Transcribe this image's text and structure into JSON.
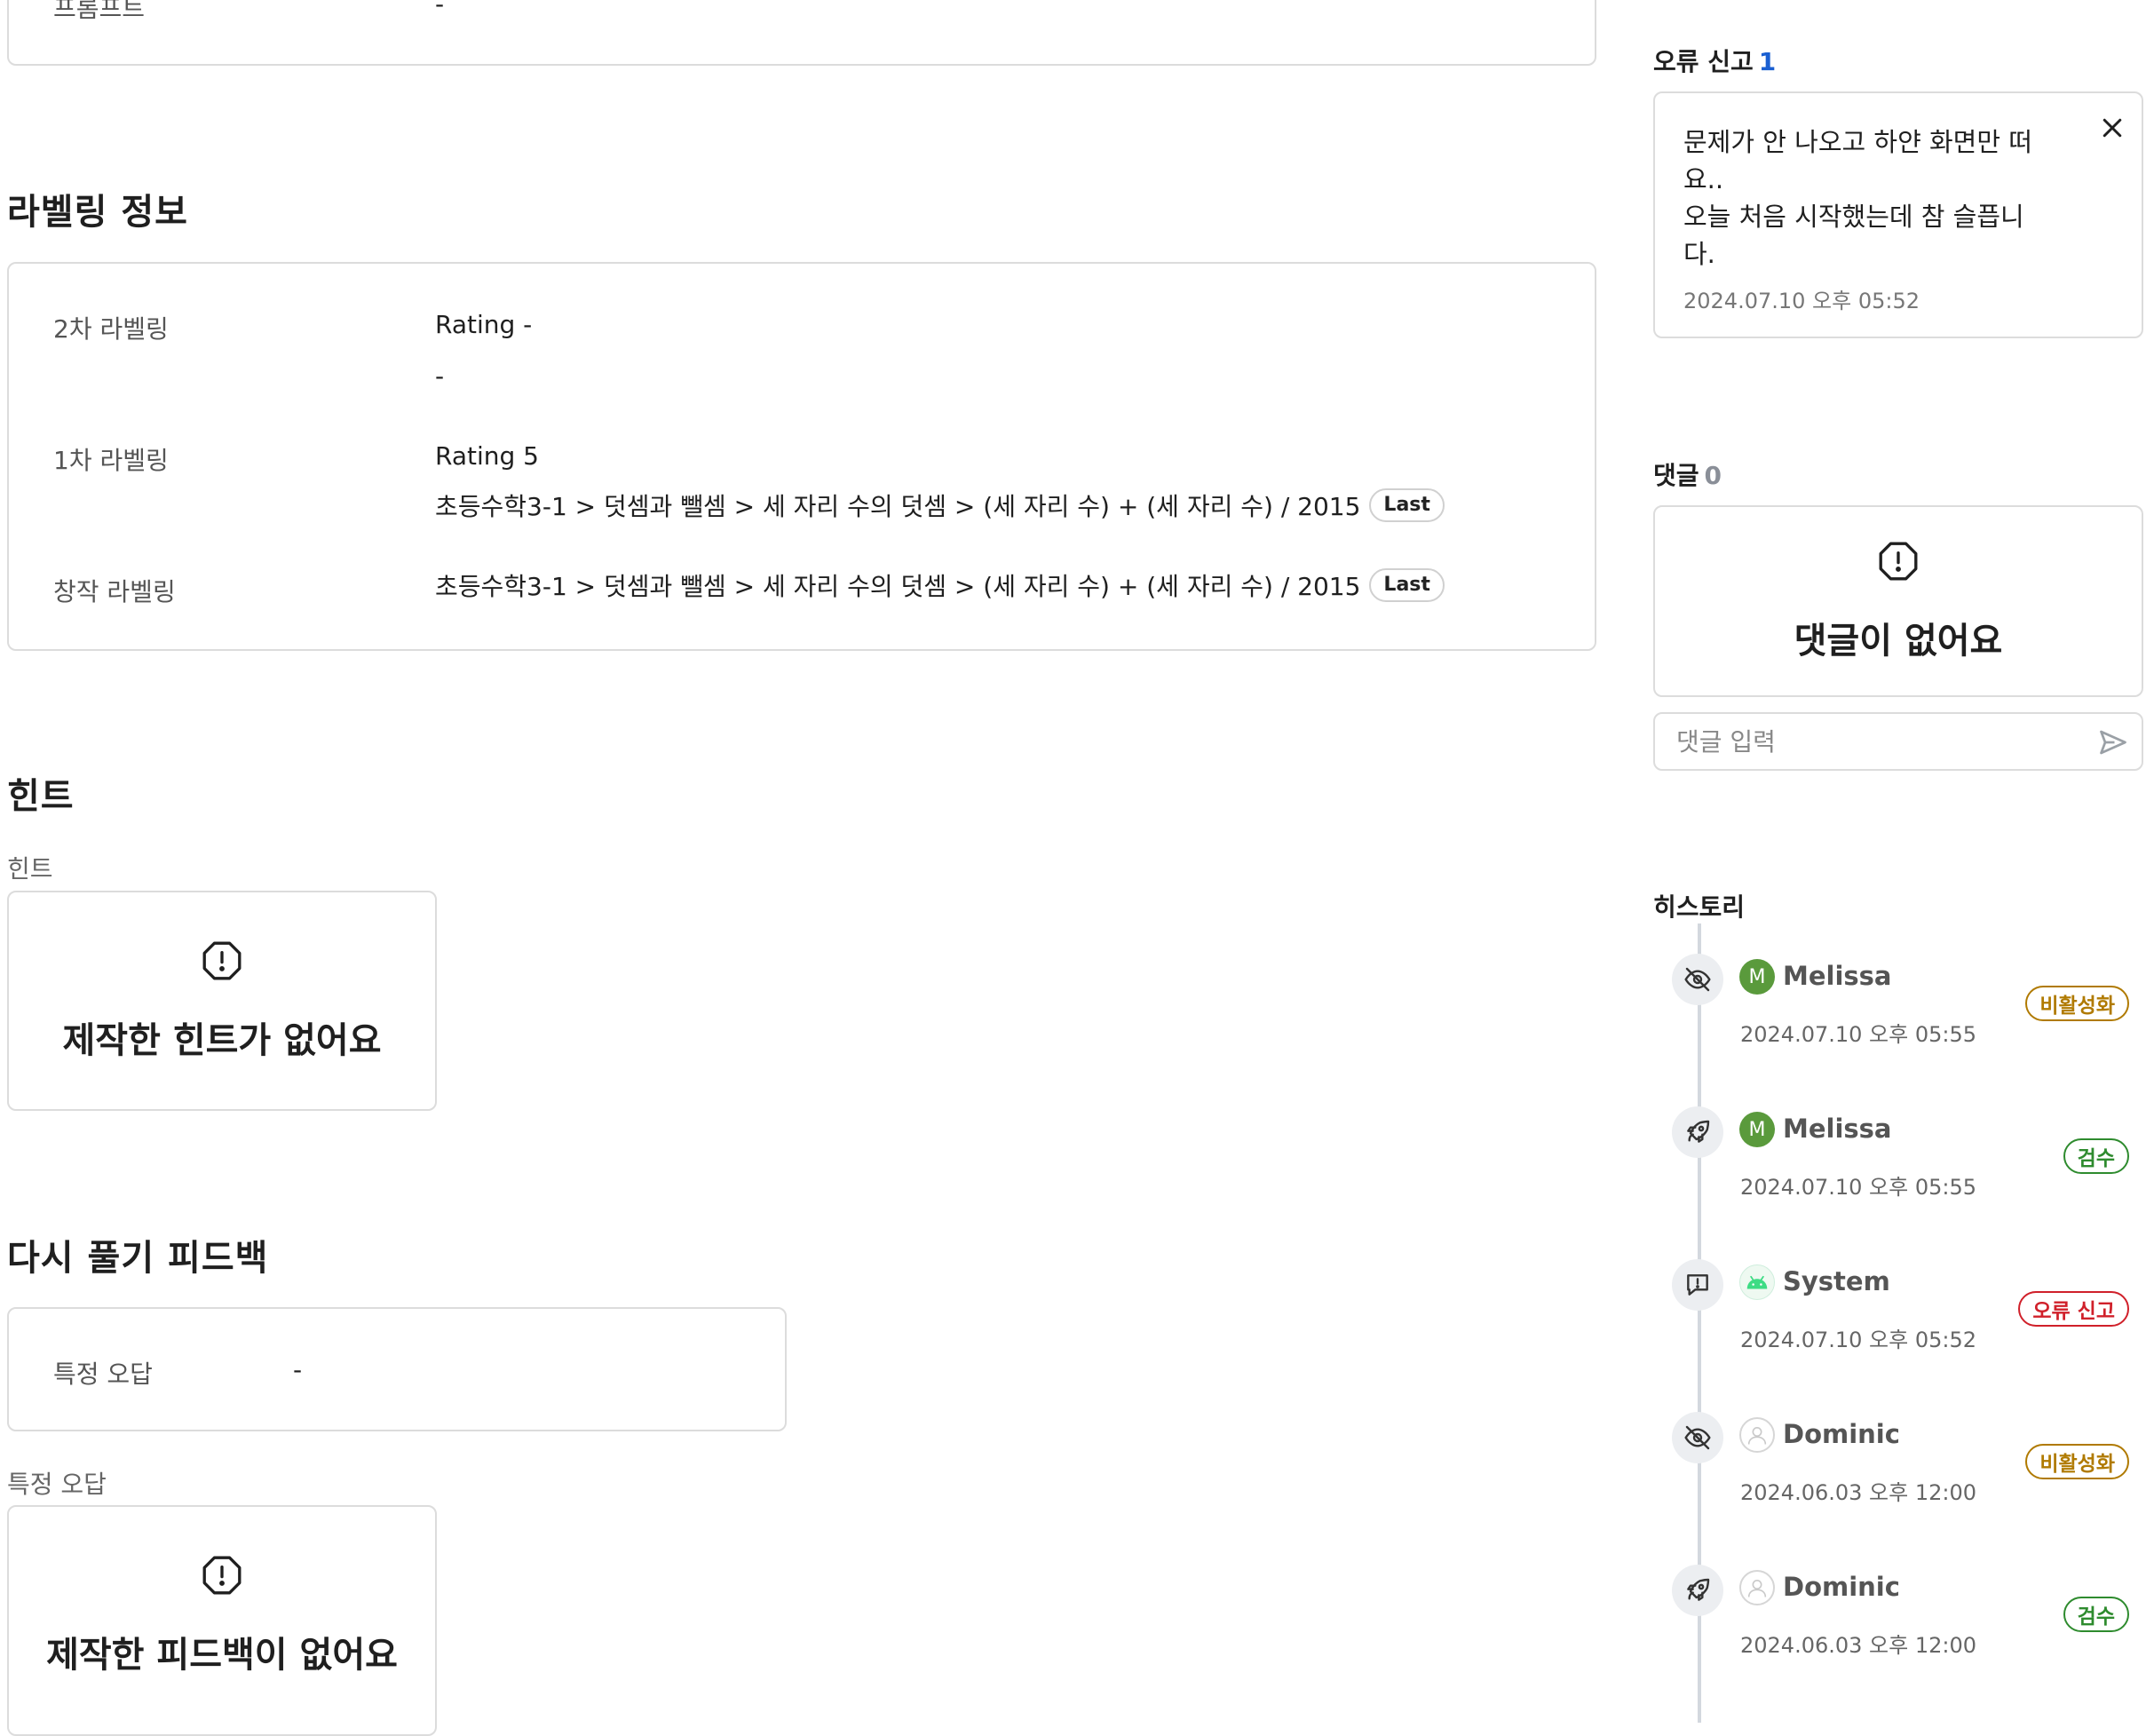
{
  "top": {
    "prompt_label": "프롬프트",
    "prompt_value": "-"
  },
  "labeling": {
    "title": "라벨링 정보",
    "second": {
      "label": "2차 라벨링",
      "rating": "Rating -",
      "value": "-"
    },
    "first": {
      "label": "1차 라벨링",
      "rating": "Rating 5",
      "path": "초등수학3-1 > 덧셈과 뺄셈 > 세 자리 수의 덧셈 > (세 자리 수) + (세 자리 수) / 2015",
      "tag": "Last"
    },
    "creation": {
      "label": "창작 라벨링",
      "path": "초등수학3-1 > 덧셈과 뺄셈 > 세 자리 수의 덧셈 > (세 자리 수) + (세 자리 수) / 2015",
      "tag": "Last"
    }
  },
  "hint": {
    "title": "힌트",
    "sublabel": "힌트",
    "empty": "제작한 힌트가 없어요"
  },
  "feedback": {
    "title": "다시 풀기 피드백",
    "row_label": "특정 오답",
    "row_value": "-",
    "sublabel": "특정 오답",
    "empty": "제작한 피드백이 없어요"
  },
  "error_report": {
    "title": "오류 신고",
    "count": "1",
    "text_lines": [
      "문제가 안 나오고 하얀 화면만 떠",
      "요..",
      "오늘 처음 시작했는데 참 슬픕니",
      "다."
    ],
    "time": "2024.07.10 오후 05:52"
  },
  "comments": {
    "title": "댓글",
    "count": "0",
    "empty": "댓글이 없어요",
    "input_placeholder": "댓글 입력"
  },
  "history": {
    "title": "히스토리",
    "events": [
      {
        "icon": "eye-off-icon",
        "avatar": "M",
        "avatar_color": "#5a9a3c",
        "name": "Melissa",
        "time": "2024.07.10 오후 05:55",
        "badge": "비활성화",
        "badge_color": "#b07a00"
      },
      {
        "icon": "rocket-icon",
        "avatar": "M",
        "avatar_color": "#5a9a3c",
        "name": "Melissa",
        "time": "2024.07.10 오후 05:55",
        "badge": "검수",
        "badge_color": "#2e8b2e"
      },
      {
        "icon": "message-alert-icon",
        "avatar": "android",
        "avatar_color": "#3ddc84",
        "name": "System",
        "time": "2024.07.10 오후 05:52",
        "badge": "오류 신고",
        "badge_color": "#d0202a"
      },
      {
        "icon": "eye-off-icon",
        "avatar": "user",
        "avatar_color": "#cfcfcf",
        "name": "Dominic",
        "time": "2024.06.03 오후 12:00",
        "badge": "비활성화",
        "badge_color": "#b07a00"
      },
      {
        "icon": "rocket-icon",
        "avatar": "user",
        "avatar_color": "#cfcfcf",
        "name": "Dominic",
        "time": "2024.06.03 오후 12:00",
        "badge": "검수",
        "badge_color": "#2e8b2e"
      }
    ]
  }
}
